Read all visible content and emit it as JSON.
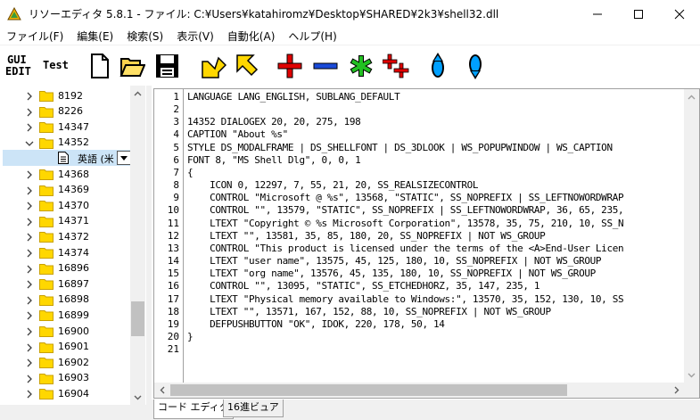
{
  "window": {
    "title": "リソーエディタ 5.8.1 - ファイル: C:¥Users¥katahiromz¥Desktop¥SHARED¥2k3¥shell32.dll"
  },
  "menu": [
    {
      "label": "ファイル(F)"
    },
    {
      "label": "編集(E)"
    },
    {
      "label": "検索(S)"
    },
    {
      "label": "表示(V)"
    },
    {
      "label": "自動化(A)"
    },
    {
      "label": "ヘルプ(H)"
    }
  ],
  "toolbar": {
    "gui_edit_line1": "GUI",
    "gui_edit_line2": "EDIT",
    "test_label": "Test",
    "icons": [
      "new-file-icon",
      "open-folder-icon",
      "save-disk-icon",
      "arrow-down-right-icon",
      "arrow-up-left-icon",
      "add-plus-icon",
      "delete-minus-icon",
      "asterisk-icon",
      "add-multiple-icon",
      "move-up-icon",
      "move-down-icon"
    ]
  },
  "tree": {
    "items": [
      {
        "label": "8192",
        "expanded": false
      },
      {
        "label": "8226",
        "expanded": false
      },
      {
        "label": "14347",
        "expanded": false
      },
      {
        "label": "14352",
        "expanded": true
      },
      {
        "label": "14368",
        "expanded": false
      },
      {
        "label": "14369",
        "expanded": false
      },
      {
        "label": "14370",
        "expanded": false
      },
      {
        "label": "14371",
        "expanded": false
      },
      {
        "label": "14372",
        "expanded": false
      },
      {
        "label": "14374",
        "expanded": false
      },
      {
        "label": "16896",
        "expanded": false
      },
      {
        "label": "16897",
        "expanded": false
      },
      {
        "label": "16898",
        "expanded": false
      },
      {
        "label": "16899",
        "expanded": false
      },
      {
        "label": "16900",
        "expanded": false
      },
      {
        "label": "16901",
        "expanded": false
      },
      {
        "label": "16902",
        "expanded": false
      },
      {
        "label": "16903",
        "expanded": false
      },
      {
        "label": "16904",
        "expanded": false
      }
    ],
    "selected_child": {
      "label": "英語 (米"
    }
  },
  "editor": {
    "line_numbers": [
      "1",
      "2",
      "3",
      "4",
      "5",
      "6",
      "7",
      "8",
      "9",
      "10",
      "11",
      "12",
      "13",
      "14",
      "15",
      "16",
      "17",
      "18",
      "19",
      "20",
      "21"
    ],
    "lines": [
      "LANGUAGE LANG_ENGLISH, SUBLANG_DEFAULT",
      "",
      "14352 DIALOGEX 20, 20, 275, 198",
      "CAPTION \"About %s\"",
      "STYLE DS_MODALFRAME | DS_SHELLFONT | DS_3DLOOK | WS_POPUPWINDOW | WS_CAPTION",
      "FONT 8, \"MS Shell Dlg\", 0, 0, 1",
      "{",
      "    ICON 0, 12297, 7, 55, 21, 20, SS_REALSIZECONTROL",
      "    CONTROL \"Microsoft @ %s\", 13568, \"STATIC\", SS_NOPREFIX | SS_LEFTNOWORDWRAP",
      "    CONTROL \"\", 13579, \"STATIC\", SS_NOPREFIX | SS_LEFTNOWORDWRAP, 36, 65, 235,",
      "    LTEXT \"Copyright © %s Microsoft Corporation\", 13578, 35, 75, 210, 10, SS_N",
      "    LTEXT \"\", 13581, 35, 85, 180, 20, SS_NOPREFIX | NOT WS_GROUP",
      "    CONTROL \"This product is licensed under the terms of the <A>End-User Licen",
      "    LTEXT \"user name\", 13575, 45, 125, 180, 10, SS_NOPREFIX | NOT WS_GROUP",
      "    LTEXT \"org name\", 13576, 45, 135, 180, 10, SS_NOPREFIX | NOT WS_GROUP",
      "    CONTROL \"\", 13095, \"STATIC\", SS_ETCHEDHORZ, 35, 147, 235, 1",
      "    LTEXT \"Physical memory available to Windows:\", 13570, 35, 152, 130, 10, SS",
      "    LTEXT \"\", 13571, 167, 152, 88, 10, SS_NOPREFIX | NOT WS_GROUP",
      "    DEFPUSHBUTTON \"OK\", IDOK, 220, 178, 50, 14",
      "}",
      ""
    ]
  },
  "tabs": [
    {
      "label": "コード エディタ",
      "active": true
    },
    {
      "label": "16進ビュア",
      "active": false
    }
  ],
  "colors": {
    "folder": "#ffd700",
    "selection": "#cce4f7",
    "scrollbar": "#f0f0f0",
    "thumb": "#c1c1c1"
  }
}
